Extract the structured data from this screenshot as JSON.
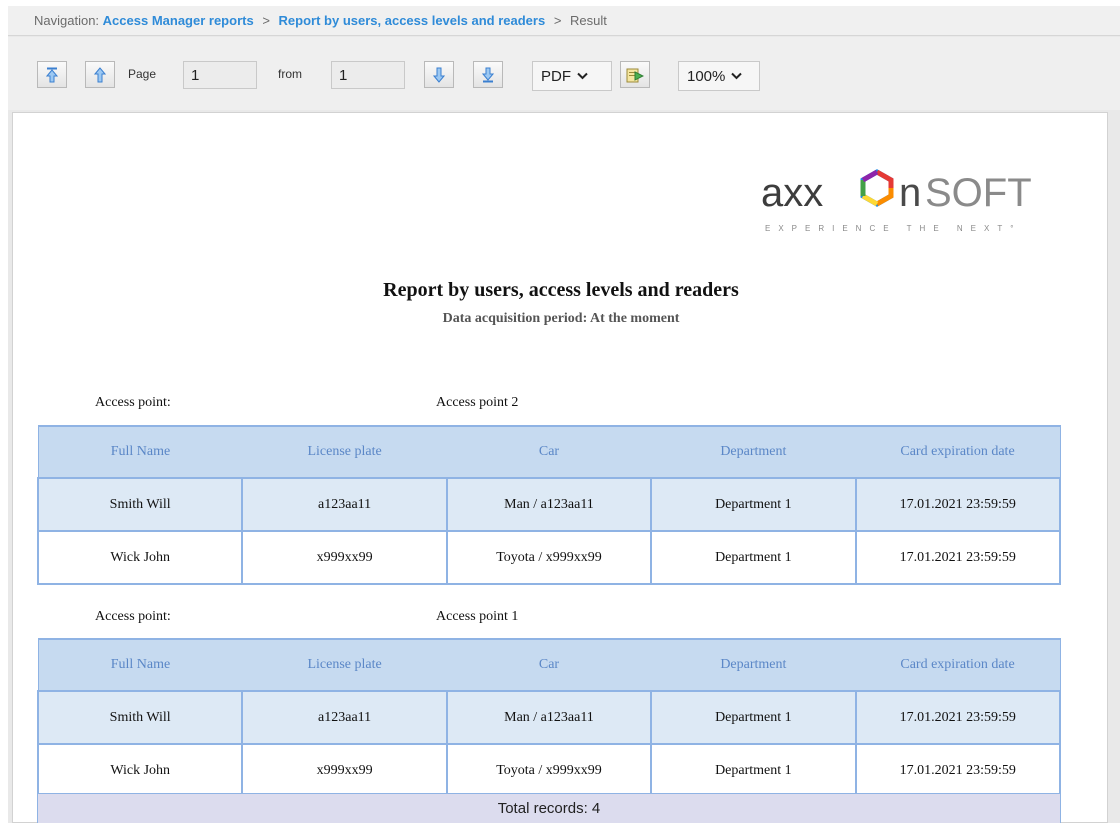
{
  "breadcrumb": {
    "prefix": "Navigation:",
    "crumbs": [
      "Access Manager reports",
      "Report by users, access levels and readers"
    ],
    "separator": ">",
    "current": "Result"
  },
  "toolbar": {
    "page_label": "Page",
    "page_value": "1",
    "from_label": "from",
    "from_value": "1",
    "format": "PDF",
    "zoom": "100%",
    "icons": {
      "first": "first-page-icon",
      "prev": "previous-page-icon",
      "next": "next-page-icon",
      "last": "last-page-icon",
      "export": "export-icon",
      "dropdown": "chevron-down-icon"
    }
  },
  "report": {
    "logo_main": "axx",
    "logo_on": "on",
    "logo_soft": "SOFT",
    "logo_tagline": "EXPERIENCE THE NEXT°",
    "title": "Report by users, access levels and readers",
    "subtitle": "Data acquisition period: At the moment",
    "columns": [
      "Full Name",
      "License plate",
      "Car",
      "Department",
      "Card expiration date"
    ],
    "sections": [
      {
        "label": "Access point:",
        "value": "Access point 2",
        "rows": [
          [
            "Smith Will",
            "a123aa11",
            "Man / a123aa11",
            "Department 1",
            "17.01.2021 23:59:59"
          ],
          [
            "Wick John",
            "x999xx99",
            "Toyota / x999xx99",
            "Department 1",
            "17.01.2021 23:59:59"
          ]
        ]
      },
      {
        "label": "Access point:",
        "value": "Access point 1",
        "rows": [
          [
            "Smith Will",
            "a123aa11",
            "Man / a123aa11",
            "Department 1",
            "17.01.2021 23:59:59"
          ],
          [
            "Wick John",
            "x999xx99",
            "Toyota / x999xx99",
            "Department 1",
            "17.01.2021 23:59:59"
          ]
        ]
      }
    ],
    "total": "Total records: 4"
  },
  "colors": {
    "link": "#2f8bd8",
    "header_bg": "#c6daf0",
    "header_text": "#5b87c7",
    "border": "#8fb3e4",
    "odd_row": "#dde9f5",
    "total_bg": "#dcdcee",
    "logo_ring": [
      "#e53935",
      "#fb8c00",
      "#fdd835",
      "#43a047",
      "#1e88e5",
      "#8e24aa"
    ]
  }
}
